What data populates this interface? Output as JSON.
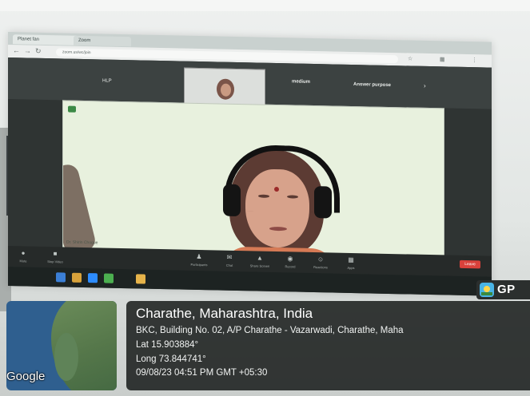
{
  "browser": {
    "tabs": [
      "Planet fan",
      "Zoom"
    ],
    "url": "zoom.us/wc/join"
  },
  "meeting": {
    "top_labels": {
      "left": "HLP",
      "center": "medium",
      "right": "Answer purpose"
    },
    "speaker_name": "Dr. Shirin Chogue",
    "controls": [
      "Mute",
      "Stop Video",
      "Participants",
      "Chat",
      "Share Screen",
      "Record",
      "Reactions",
      "Apps",
      "Leave"
    ]
  },
  "gps": {
    "badge_text": "GP",
    "map_watermark": "Google",
    "location_title": "Charathe, Maharashtra, India",
    "address": "BKC, Building No. 02, A/P Charathe - Vazarwadi, Charathe, Maha",
    "lat": "Lat 15.903884°",
    "long": "Long 73.844741°",
    "datetime": "09/08/23 04:51 PM GMT +05:30"
  }
}
